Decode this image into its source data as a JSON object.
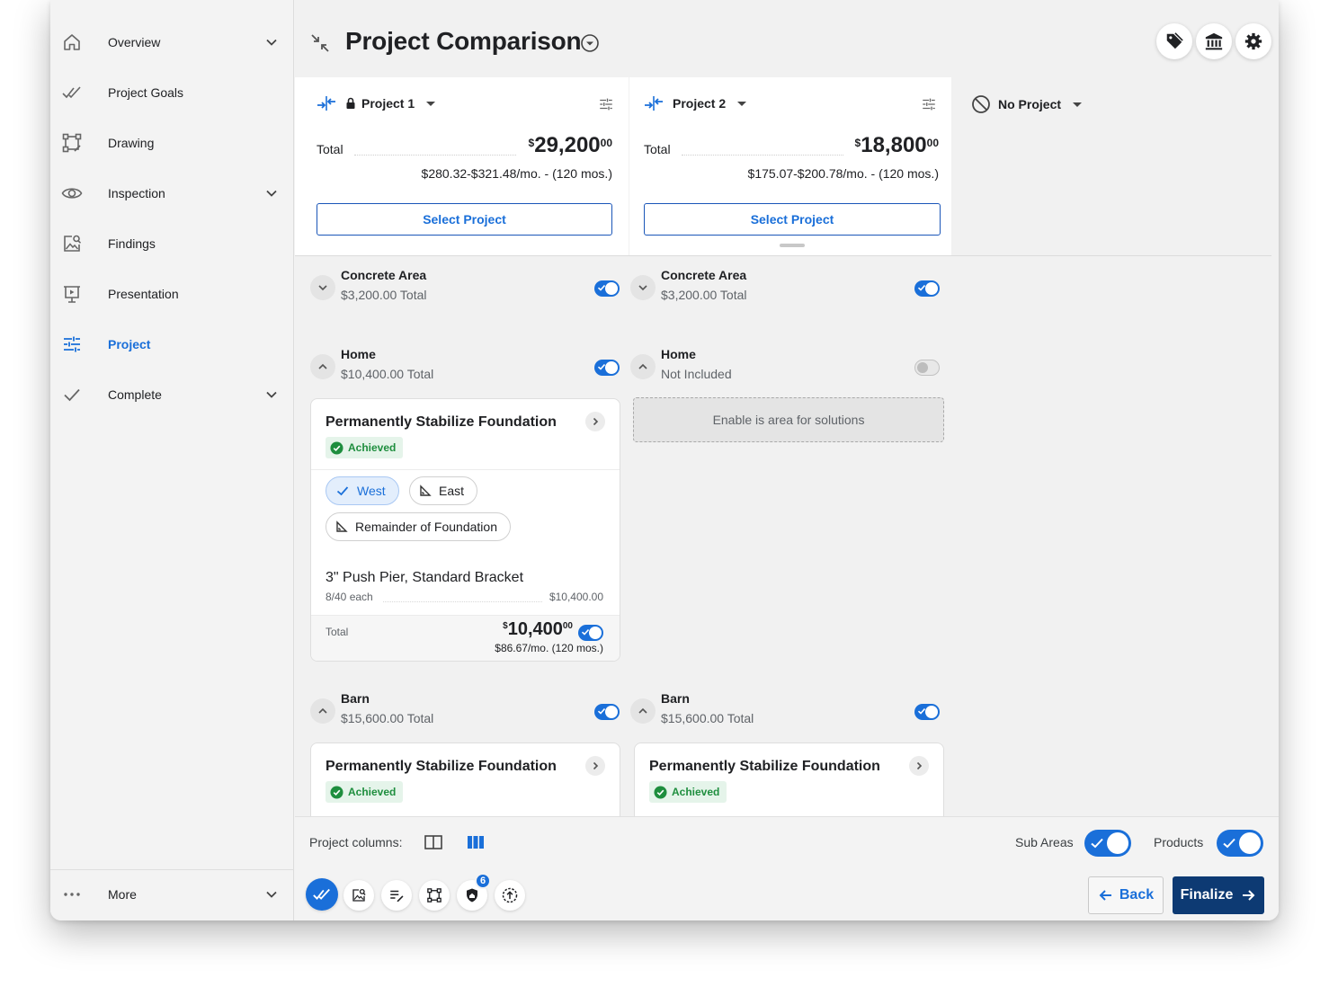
{
  "sidebar": {
    "items": [
      {
        "label": "Overview",
        "icon": "home-icon",
        "chevron": true
      },
      {
        "label": "Project Goals",
        "icon": "double-check-icon",
        "chevron": false
      },
      {
        "label": "Drawing",
        "icon": "drawing-icon",
        "chevron": false
      },
      {
        "label": "Inspection",
        "icon": "eye-icon",
        "chevron": true
      },
      {
        "label": "Findings",
        "icon": "findings-icon",
        "chevron": false
      },
      {
        "label": "Presentation",
        "icon": "presentation-icon",
        "chevron": false
      },
      {
        "label": "Project",
        "icon": "tune-icon",
        "chevron": false,
        "active": true
      },
      {
        "label": "Complete",
        "icon": "check-icon",
        "chevron": true
      }
    ],
    "more_label": "More"
  },
  "header": {
    "title": "Project Comparison"
  },
  "projects": [
    {
      "name": "Project 1",
      "locked": true,
      "total_label": "Total",
      "price_symbol": "$",
      "price_main": "29,200",
      "price_cents": "00",
      "monthly": "$280.32-$321.48/mo. - (120 mos.)",
      "select_label": "Select Project"
    },
    {
      "name": "Project 2",
      "locked": false,
      "total_label": "Total",
      "price_symbol": "$",
      "price_main": "18,800",
      "price_cents": "00",
      "monthly": "$175.07-$200.78/mo. - (120 mos.)",
      "select_label": "Select Project"
    }
  ],
  "no_project_label": "No Project",
  "areas": {
    "p1_concrete": {
      "name": "Concrete Area",
      "sub": "$3,200.00 Total",
      "enabled": true
    },
    "p2_concrete": {
      "name": "Concrete Area",
      "sub": "$3,200.00 Total",
      "enabled": true
    },
    "p1_home": {
      "name": "Home",
      "sub": "$10,400.00 Total",
      "enabled": true
    },
    "p2_home": {
      "name": "Home",
      "sub": "Not Included",
      "enabled": false
    },
    "p1_barn": {
      "name": "Barn",
      "sub": "$15,600.00 Total",
      "enabled": true
    },
    "p2_barn": {
      "name": "Barn",
      "sub": "$15,600.00 Total",
      "enabled": true
    }
  },
  "solution_card": {
    "title": "Permanently Stabilize Foundation",
    "badge": "Achieved",
    "chips": [
      {
        "label": "West",
        "selected": true
      },
      {
        "label": "East",
        "selected": false
      },
      {
        "label": "Remainder of Foundation",
        "selected": false
      }
    ],
    "product_name": "3\" Push Pier, Standard Bracket",
    "product_qty": "8/40 each",
    "product_price": "$10,400.00",
    "total_label": "Total",
    "total_symbol": "$",
    "total_main": "10,400",
    "total_cents": "00",
    "total_monthly": "$86.67/mo. (120 mos.)"
  },
  "barn_cards": [
    {
      "title": "Permanently Stabilize Foundation",
      "badge": "Achieved"
    },
    {
      "title": "Permanently Stabilize Foundation",
      "badge": "Achieved"
    }
  ],
  "placeholder_text": "Enable is area for solutions",
  "bottom": {
    "project_columns_label": "Project columns:",
    "sub_areas_label": "Sub Areas",
    "products_label": "Products",
    "sub_areas_on": true,
    "products_on": true,
    "notification_count": "6",
    "back_label": "Back",
    "finalize_label": "Finalize"
  },
  "colors": {
    "accent": "#1a6fd9",
    "finalize": "#0d3a73",
    "achieved_bg": "#e5f4ea",
    "achieved_text": "#1e8e3e"
  }
}
